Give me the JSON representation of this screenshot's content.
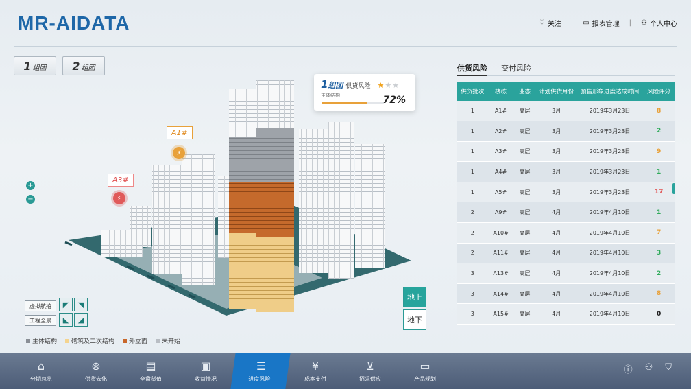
{
  "app": {
    "title": "MR-AIDATA"
  },
  "header": {
    "follow": "关注",
    "report_mgmt": "报表管理",
    "personal_center": "个人中心"
  },
  "groups": [
    {
      "num": "1",
      "label": "组团"
    },
    {
      "num": "2",
      "label": "组团"
    }
  ],
  "info_card": {
    "group_num": "1",
    "group_label": "组团",
    "category": "供货风险",
    "stars_on": 1,
    "stars_total": 3,
    "sub_label": "主体结构",
    "percent": "72%",
    "progress": 0.72
  },
  "building_tags": {
    "a1": "A1#",
    "a3": "A3#"
  },
  "controls": {
    "zoom_in": "+",
    "zoom_out": "−",
    "virtual_flight": "虚拟航拍",
    "project_panorama": "工程全景",
    "above_ground": "地上",
    "below_ground": "地下"
  },
  "legend": [
    {
      "label": "主体结构",
      "color": "#8a8f96"
    },
    {
      "label": "砌筑及二次结构",
      "color": "#f4d48f"
    },
    {
      "label": "外立面",
      "color": "#c8672a"
    },
    {
      "label": "未开始",
      "color": "#b9bec4"
    }
  ],
  "panel": {
    "tabs": [
      "供货风险",
      "交付风险"
    ],
    "columns": [
      "供货批次",
      "楼栋",
      "业态",
      "计划供货月份",
      "预售形象进度达成时间",
      "风险评分"
    ],
    "rows": [
      [
        "1",
        "A1#",
        "高层",
        "3月",
        "2019年3月23日",
        "8"
      ],
      [
        "1",
        "A2#",
        "高层",
        "3月",
        "2019年3月23日",
        "2"
      ],
      [
        "1",
        "A3#",
        "高层",
        "3月",
        "2019年3月23日",
        "9"
      ],
      [
        "1",
        "A4#",
        "高层",
        "3月",
        "2019年3月23日",
        "1"
      ],
      [
        "1",
        "A5#",
        "高层",
        "3月",
        "2019年3月23日",
        "17"
      ],
      [
        "2",
        "A9#",
        "高层",
        "4月",
        "2019年4月10日",
        "1"
      ],
      [
        "2",
        "A10#",
        "高层",
        "4月",
        "2019年4月10日",
        "7"
      ],
      [
        "2",
        "A11#",
        "高层",
        "4月",
        "2019年4月10日",
        "3"
      ],
      [
        "3",
        "A13#",
        "高层",
        "4月",
        "2019年4月10日",
        "2"
      ],
      [
        "3",
        "A14#",
        "高层",
        "4月",
        "2019年4月10日",
        "8"
      ],
      [
        "3",
        "A15#",
        "高层",
        "4月",
        "2019年4月10日",
        "0"
      ]
    ],
    "score_colors": [
      "#e8a13a",
      "#2faa5a",
      "#e8a13a",
      "#2faa5a",
      "#e05353",
      "#2faa5a",
      "#e8a13a",
      "#2faa5a",
      "#2faa5a",
      "#e8a13a",
      "#222222"
    ]
  },
  "nav": {
    "items": [
      {
        "label": "分期总览",
        "icon": "home-icon"
      },
      {
        "label": "供货去化",
        "icon": "coin-icon"
      },
      {
        "label": "全盘货值",
        "icon": "document-icon"
      },
      {
        "label": "收益情况",
        "icon": "wallet-icon"
      },
      {
        "label": "进度风险",
        "icon": "sliders-icon"
      },
      {
        "label": "成本支付",
        "icon": "cash-icon"
      },
      {
        "label": "招采供应",
        "icon": "cart-icon"
      },
      {
        "label": "产品规划",
        "icon": "presentation-icon"
      }
    ],
    "active_index": 4
  }
}
